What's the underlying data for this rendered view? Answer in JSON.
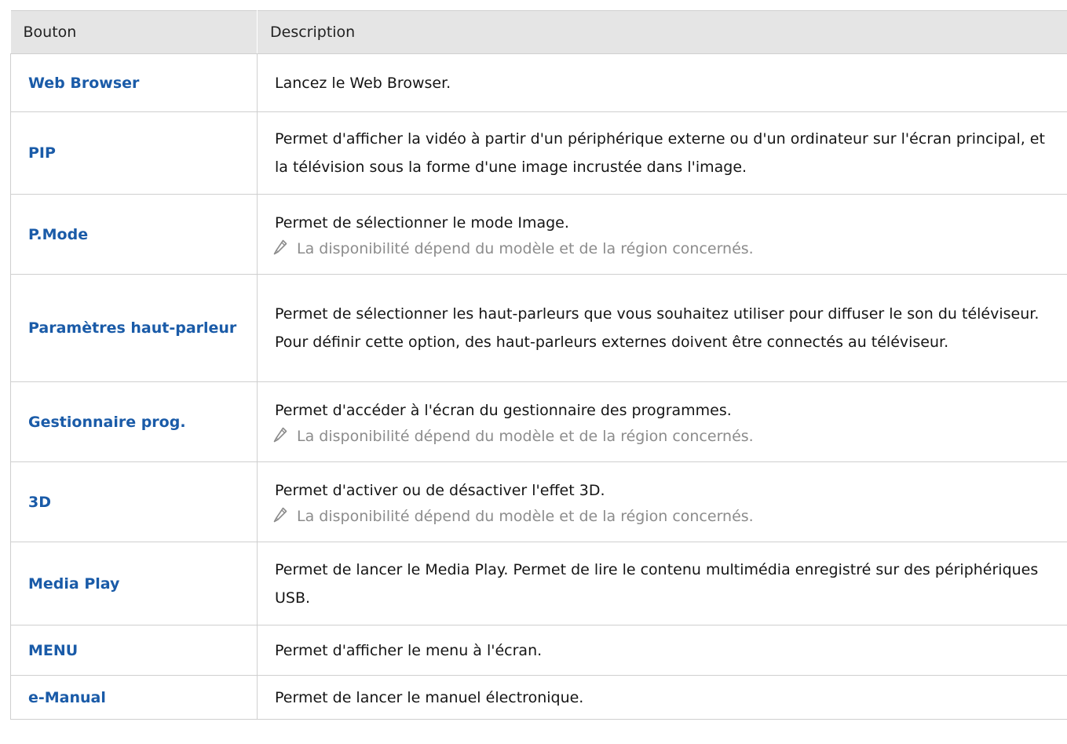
{
  "table": {
    "headers": [
      "Bouton",
      "Description"
    ],
    "rows": [
      {
        "button": "Web Browser",
        "description": "Lancez le Web Browser.",
        "note": ""
      },
      {
        "button": "PIP",
        "description": "Permet d'afficher la vidéo à partir d'un périphérique externe ou d'un ordinateur sur l'écran principal, et la télévision sous la forme d'une image incrustée dans l'image.",
        "note": ""
      },
      {
        "button": "P.Mode",
        "description": "Permet de sélectionner le mode Image.",
        "note": "La disponibilité dépend du modèle et de la région concernés."
      },
      {
        "button": "Paramètres haut-parleur",
        "description": "Permet de sélectionner les haut-parleurs que vous souhaitez utiliser pour diffuser le son du téléviseur. Pour définir cette option, des haut-parleurs externes doivent être connectés au téléviseur.",
        "note": ""
      },
      {
        "button": "Gestionnaire prog.",
        "description": "Permet d'accéder à l'écran du gestionnaire des programmes.",
        "note": "La disponibilité dépend du modèle et de la région concernés."
      },
      {
        "button": "3D",
        "description": "Permet d'activer ou de désactiver l'effet 3D.",
        "note": "La disponibilité dépend du modèle et de la région concernés."
      },
      {
        "button": "Media Play",
        "description": "Permet de lancer le Media Play. Permet de lire le contenu multimédia enregistré sur des périphériques USB.",
        "note": ""
      },
      {
        "button": "MENU",
        "description": "Permet d'afficher le menu à l'écran.",
        "note": ""
      },
      {
        "button": "e-Manual",
        "description": "Permet de lancer le manuel électronique.",
        "note": ""
      }
    ]
  },
  "colors": {
    "button_text": "#1a5ba8",
    "header_bg": "#e5e5e5",
    "note_text": "#8c8c8c",
    "border": "#cfcfcf"
  },
  "icons": {
    "note": "pencil-icon"
  }
}
